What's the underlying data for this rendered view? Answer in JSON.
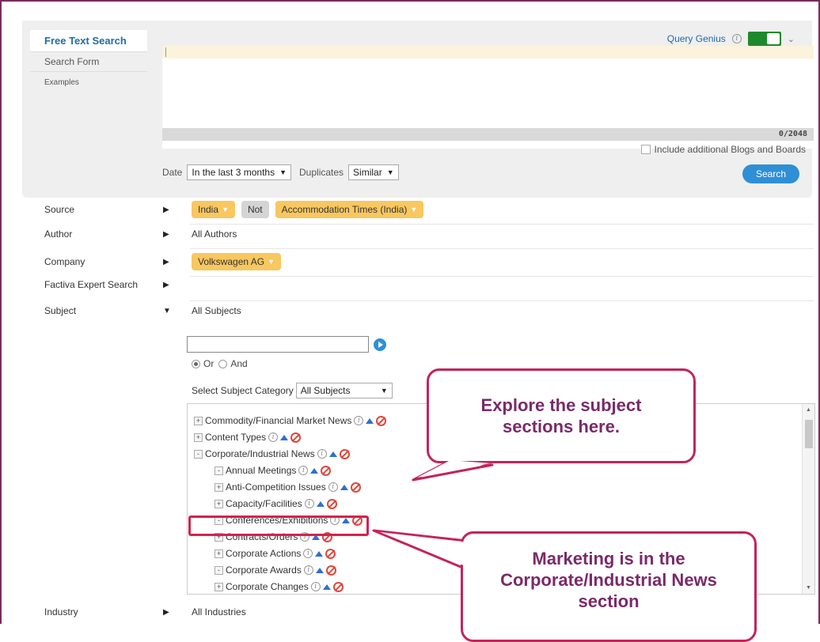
{
  "search_panel": {
    "tabs": [
      "Free Text Search",
      "Search Form",
      "Examples"
    ],
    "query_genius": "Query Genius",
    "counter": "0/2048",
    "include_blogs": "Include additional Blogs and Boards",
    "date_label": "Date",
    "date_value": "In the last 3 months",
    "duplicates_label": "Duplicates",
    "duplicates_value": "Similar",
    "search_button": "Search"
  },
  "filters": {
    "source": {
      "label": "Source",
      "chips": [
        "India",
        "Not",
        "Accommodation Times (India)"
      ]
    },
    "author": {
      "label": "Author",
      "value": "All Authors"
    },
    "company": {
      "label": "Company",
      "chips": [
        "Volkswagen AG"
      ]
    },
    "expert": {
      "label": "Factiva Expert Search"
    },
    "subject": {
      "label": "Subject",
      "value": "All Subjects"
    },
    "industry": {
      "label": "Industry",
      "value": "All Industries"
    }
  },
  "subject_panel": {
    "or_label": "Or",
    "and_label": "And",
    "category_label": "Select Subject Category",
    "category_value": "All Subjects",
    "tree": [
      {
        "sign": "+",
        "label": "Commodity/Financial Market News"
      },
      {
        "sign": "+",
        "label": "Content Types"
      },
      {
        "sign": "-",
        "label": "Corporate/Industrial News"
      },
      {
        "sign": "-",
        "label": "Annual Meetings"
      },
      {
        "sign": "+",
        "label": "Anti-Competition Issues"
      },
      {
        "sign": "+",
        "label": "Capacity/Facilities"
      },
      {
        "sign": "-",
        "label": "Conferences/Exhibitions"
      },
      {
        "sign": "+",
        "label": "Contracts/Orders"
      },
      {
        "sign": "+",
        "label": "Corporate Actions"
      },
      {
        "sign": "-",
        "label": "Corporate Awards"
      },
      {
        "sign": "+",
        "label": "Corporate Changes"
      }
    ]
  },
  "callouts": {
    "explore": "Explore the subject sections here.",
    "marketing": "Marketing is in the Corporate/Industrial News section"
  },
  "colors": {
    "accent": "#2f8fd6",
    "chip": "#f9c75f",
    "callout_border": "#c4245a",
    "callout_text": "#7a2a6a",
    "toggle_on": "#1c8a2a"
  }
}
